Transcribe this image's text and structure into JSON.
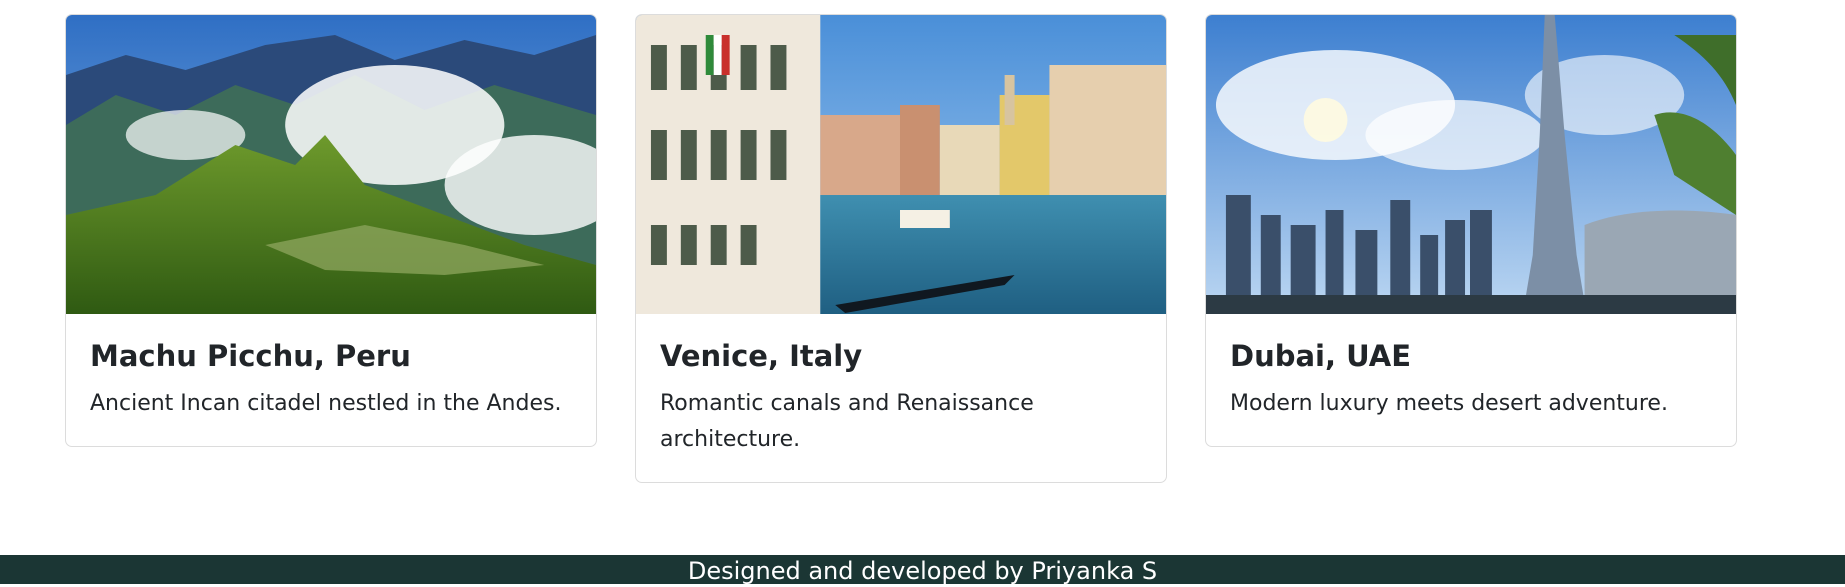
{
  "destinations": [
    {
      "title": "Machu Picchu, Peru",
      "description": "Ancient Incan citadel nestled in the Andes."
    },
    {
      "title": "Venice, Italy",
      "description": "Romantic canals and Renaissance architecture."
    },
    {
      "title": "Dubai, UAE",
      "description": "Modern luxury meets desert adventure."
    }
  ],
  "footer": {
    "credit": "Designed and developed by Priyanka S"
  }
}
